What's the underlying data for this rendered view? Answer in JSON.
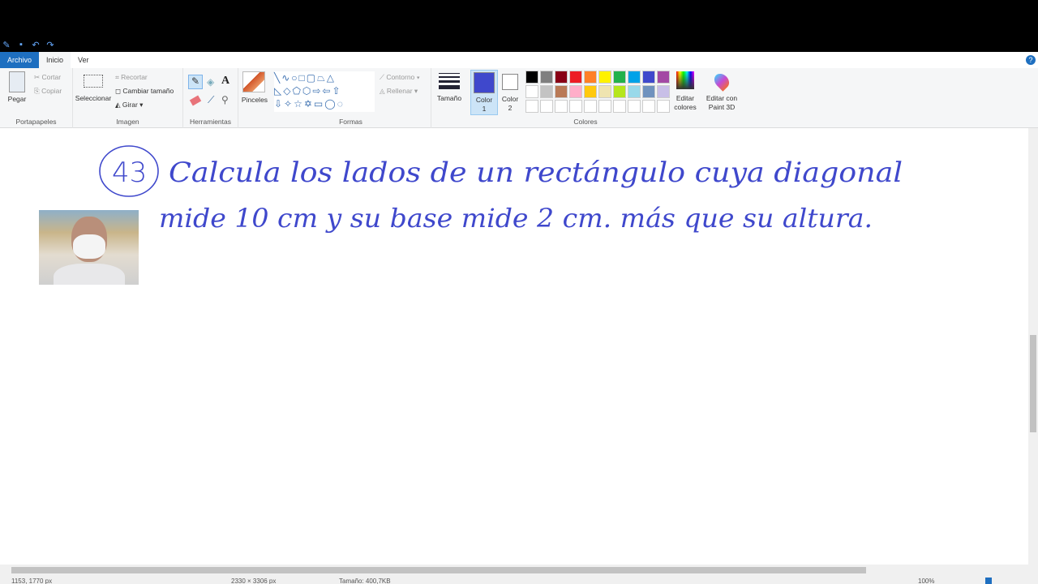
{
  "quick_access": {
    "icons": [
      "paint-app-icon",
      "save-icon",
      "undo-icon",
      "redo-icon"
    ]
  },
  "tabs": [
    "Archivo",
    "Inicio",
    "Ver"
  ],
  "ribbon": {
    "portapapeles": {
      "label": "Portapapeles",
      "paste": "Pegar",
      "cut": "Cortar",
      "copy": "Copiar"
    },
    "imagen": {
      "label": "Imagen",
      "select": "Seleccionar",
      "crop": "Recortar",
      "resize": "Cambiar tamaño",
      "rotate": "Girar"
    },
    "herramientas": {
      "label": "Herramientas"
    },
    "pinceles": {
      "label": "Pinceles"
    },
    "formas": {
      "label": "Formas",
      "outline": "Contorno",
      "fill": "Rellenar"
    },
    "tamano": {
      "label": "Tamaño"
    },
    "color1": {
      "label": "Color",
      "num": "1",
      "value": "#3f48cc"
    },
    "color2": {
      "label": "Color",
      "num": "2",
      "value": "#ffffff"
    },
    "colores": {
      "label": "Colores",
      "edit": "Editar",
      "edit2": "colores",
      "paint3d": "Editar con",
      "paint3d2": "Paint 3D",
      "row1": [
        "#000000",
        "#7f7f7f",
        "#880015",
        "#ed1c24",
        "#ff7f27",
        "#fff200",
        "#22b14c",
        "#00a2e8",
        "#3f48cc",
        "#a349a4"
      ],
      "row2": [
        "#ffffff",
        "#c3c3c3",
        "#b97a57",
        "#ffaec9",
        "#ffc90e",
        "#efe4b0",
        "#b5e61d",
        "#99d9ea",
        "#7092be",
        "#c8bfe7"
      ]
    }
  },
  "canvas": {
    "number": "43",
    "line1": "Calcula los lados de un rectángulo cuya diagonal",
    "line2": "mide 10 cm y su base mide 2 cm. más que su altura.",
    "ink_color": "#3f48cc"
  },
  "status": {
    "cursor": "1153, 1770 px",
    "size": "2330 × 3306 px",
    "file": "Tamaño: 400,7KB",
    "zoom": "100%"
  }
}
